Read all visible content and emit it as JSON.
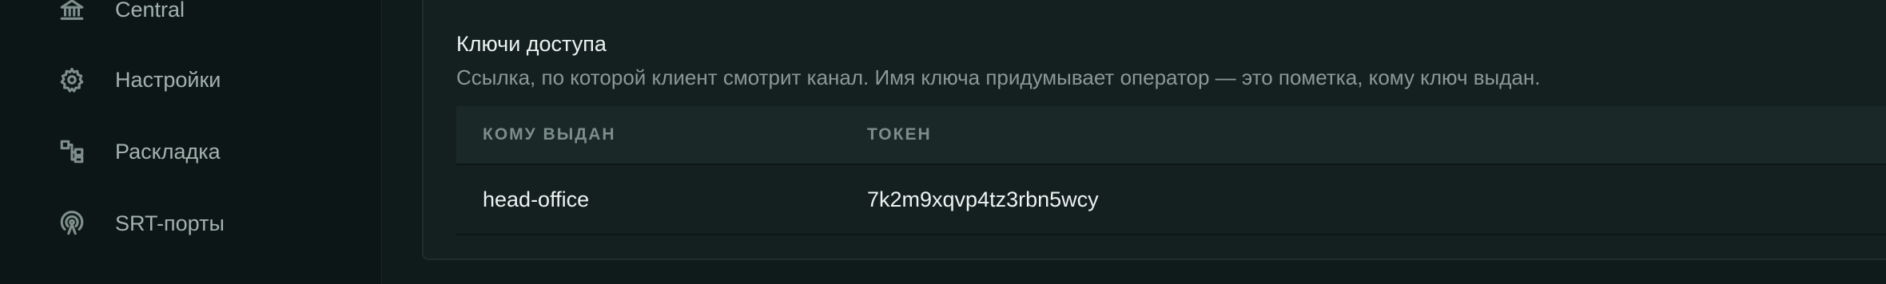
{
  "sidebar": {
    "items": [
      {
        "label": "Central",
        "icon": "bank-icon"
      },
      {
        "label": "Настройки",
        "icon": "gear-icon"
      },
      {
        "label": "Раскладка",
        "icon": "layout-icon"
      },
      {
        "label": "SRT-порты",
        "icon": "antenna-icon"
      }
    ]
  },
  "access_keys": {
    "title": "Ключи доступа",
    "description": "Ссылка, по которой клиент смотрит канал. Имя ключа придумывает оператор — это пометка, кому ключ выдан.",
    "table": {
      "columns": [
        "КОМУ ВЫДАН",
        "ТОКЕН"
      ],
      "rows": [
        {
          "holder": "head-office",
          "token": "7k2m9xqvp4tz3rbn5wcy"
        }
      ]
    }
  },
  "colors": {
    "background": "#0e1a1a",
    "card": "#142020",
    "table_header": "#1a2828",
    "muted_text": "#8a9995"
  }
}
